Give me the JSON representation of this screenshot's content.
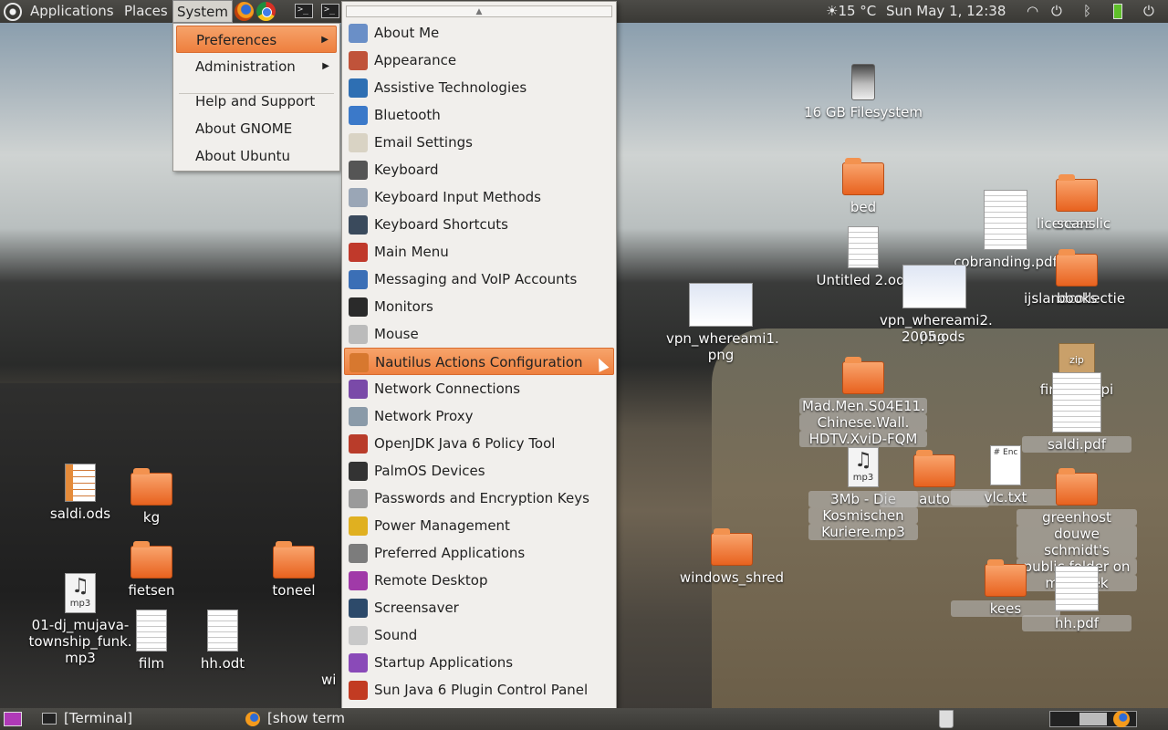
{
  "top_panel": {
    "menus": [
      "Applications",
      "Places",
      "System"
    ],
    "weather": "☀15 °C",
    "clock": "Sun May  1, 12:38"
  },
  "system_menu": {
    "items": [
      {
        "label": "Preferences",
        "submenu": true,
        "selected": true
      },
      {
        "label": "Administration",
        "submenu": true
      },
      {
        "label": "Help and Support"
      },
      {
        "label": "About GNOME"
      },
      {
        "label": "About Ubuntu"
      }
    ]
  },
  "preferences_menu": {
    "items": [
      {
        "label": "About Me",
        "icon": "user-icon"
      },
      {
        "label": "Appearance",
        "icon": "appearance-icon"
      },
      {
        "label": "Assistive Technologies",
        "icon": "accessibility-icon"
      },
      {
        "label": "Bluetooth",
        "icon": "bluetooth-icon"
      },
      {
        "label": "Email Settings",
        "icon": "email-icon"
      },
      {
        "label": "Keyboard",
        "icon": "keyboard-icon"
      },
      {
        "label": "Keyboard Input Methods",
        "icon": "info-icon"
      },
      {
        "label": "Keyboard Shortcuts",
        "icon": "shortcuts-icon"
      },
      {
        "label": "Main Menu",
        "icon": "menu-edit-icon"
      },
      {
        "label": "Messaging and VoIP Accounts",
        "icon": "messaging-icon"
      },
      {
        "label": "Monitors",
        "icon": "monitor-icon"
      },
      {
        "label": "Mouse",
        "icon": "mouse-icon"
      },
      {
        "label": "Nautilus Actions Configuration",
        "icon": "nautilus-actions-icon",
        "selected": true
      },
      {
        "label": "Network Connections",
        "icon": "network-icon"
      },
      {
        "label": "Network Proxy",
        "icon": "proxy-icon"
      },
      {
        "label": "OpenJDK Java 6 Policy Tool",
        "icon": "java-policy-icon"
      },
      {
        "label": "PalmOS Devices",
        "icon": "palm-icon"
      },
      {
        "label": "Passwords and Encryption Keys",
        "icon": "keys-icon"
      },
      {
        "label": "Power Management",
        "icon": "power-icon"
      },
      {
        "label": "Preferred Applications",
        "icon": "preferred-apps-icon"
      },
      {
        "label": "Remote Desktop",
        "icon": "remote-desktop-icon"
      },
      {
        "label": "Screensaver",
        "icon": "screensaver-icon"
      },
      {
        "label": "Sound",
        "icon": "sound-icon"
      },
      {
        "label": "Startup Applications",
        "icon": "startup-icon"
      },
      {
        "label": "Sun Java 6 Plugin Control Panel",
        "icon": "java-icon"
      }
    ]
  },
  "desktop": {
    "icons": {
      "fs16": "16 GB Filesystem",
      "bed": "bed",
      "untitled2": "Untitled 2.odt",
      "cobranding": "cobranding.pdf",
      "licenses": "licenses",
      "scanslic": "scanslic",
      "ijsland": "ijslandcollectie",
      "books": "books",
      "vpn1_a": "vpn_whereami1.",
      "vpn1_b": "png",
      "vpn2_a": "vpn_whereami2.",
      "vpn2_b": "png",
      "ods2005": "2005.ods",
      "zip": "zip",
      "firegpg": "firegpg.xpi",
      "madmen_1": "Mad.Men.S04E11.",
      "madmen_2": "Chinese.Wall.",
      "madmen_3": "HDTV.XviD-FQM",
      "saldi_pdf": "saldi.pdf",
      "kosmischen_1": "3Mb - Die",
      "kosmischen_2": "Kosmischen",
      "kosmischen_3": "Kuriere.mp3",
      "mp3_badge": "mp3",
      "auto": "auto",
      "vlc": "vlc.txt",
      "vlc_badge": "# Enc",
      "greenhost": "greenhost",
      "douwe_1": "douwe schmidt's",
      "douwe_2": "public folder on",
      "douwe_3": "mekboek",
      "windows_shred": "windows_shred",
      "kees": "kees",
      "hh_pdf": "hh.pdf",
      "saldi_ods": "saldi.ods",
      "kg": "kg",
      "fietsen": "fietsen",
      "toneel": "toneel",
      "dj_1": "01-dj_mujava-",
      "dj_2": "township_funk.",
      "dj_3": "mp3",
      "film": "film",
      "hh_odt": "hh.odt",
      "cut": "wi"
    }
  },
  "bottom_panel": {
    "task_terminal": "[Terminal]",
    "task_firefox": "[show term"
  }
}
